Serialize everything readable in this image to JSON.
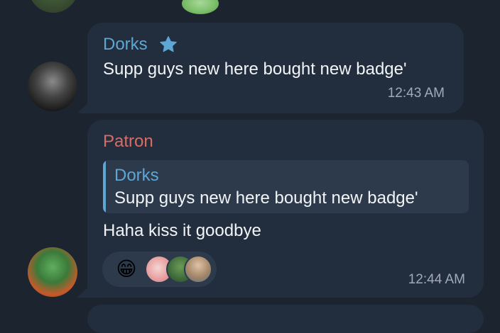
{
  "messages": [
    {
      "sender": "Dorks",
      "sender_color": "#5ea6d4",
      "badge_icon": "star-icon",
      "text": "Supp guys new here bought new badge'",
      "time": "12:43 AM"
    },
    {
      "sender": "Patron",
      "sender_color": "#d86c66",
      "reply_to": {
        "sender": "Dorks",
        "text": "Supp guys new here bought new badge'"
      },
      "text": "Haha kiss it goodbye",
      "reaction": {
        "emoji": "😁",
        "reactor_icons": [
          "reactor-avatar",
          "reactor-avatar",
          "reactor-avatar"
        ]
      },
      "time": "12:44 AM"
    }
  ],
  "colors": {
    "background": "#1c242f",
    "bubble": "#222e3d",
    "quote_background": "#2c3a4b",
    "text": "#f2f4f7",
    "timestamp": "#a1aab6"
  }
}
